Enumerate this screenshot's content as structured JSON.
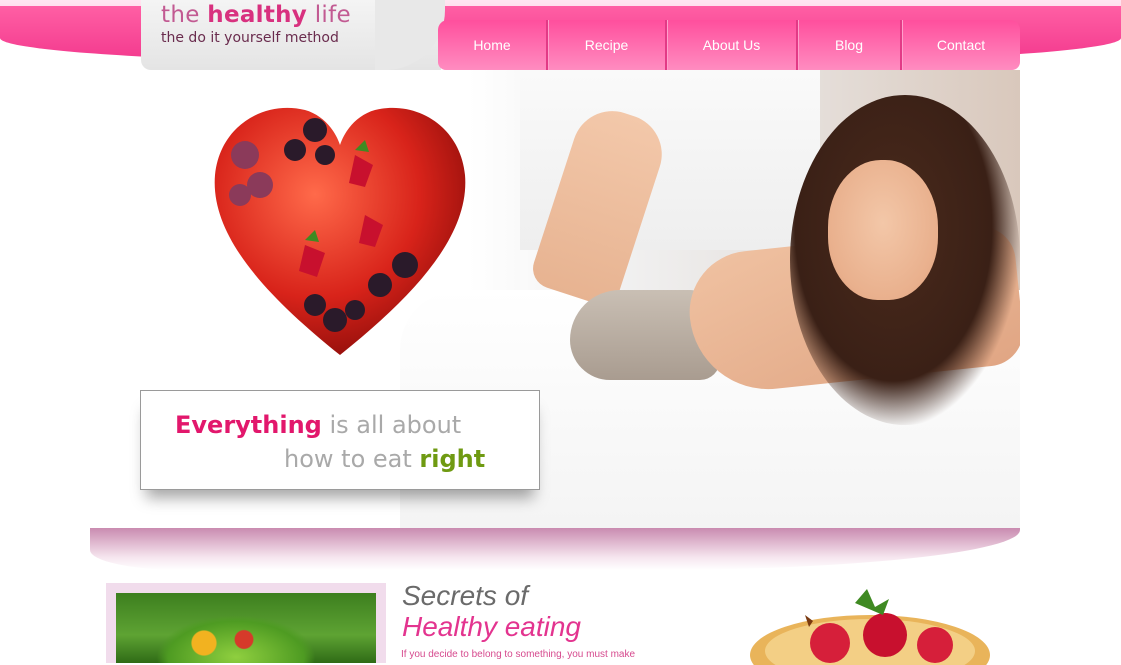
{
  "logo": {
    "title_pre": "the ",
    "title_bold": "healthy",
    "title_post": " life",
    "subtitle": "the do it yourself method"
  },
  "nav": {
    "items": [
      {
        "label": "Home"
      },
      {
        "label": "Recipe"
      },
      {
        "label": "About Us"
      },
      {
        "label": "Blog"
      },
      {
        "label": "Contact"
      }
    ]
  },
  "hero": {
    "tagline": {
      "line1_highlight": "Everything",
      "line1_rest": " is all about",
      "line2_rest": "how to eat ",
      "line2_highlight": "right"
    }
  },
  "content": {
    "heading_line1": "Secrets of",
    "heading_line2": "Healthy eating",
    "paragraph_start": "If you decide to belong to something, you must make"
  },
  "colors": {
    "brand_pink": "#e2176c",
    "nav_pink": "#ff4f9d",
    "accent_green": "#6f9a12"
  }
}
